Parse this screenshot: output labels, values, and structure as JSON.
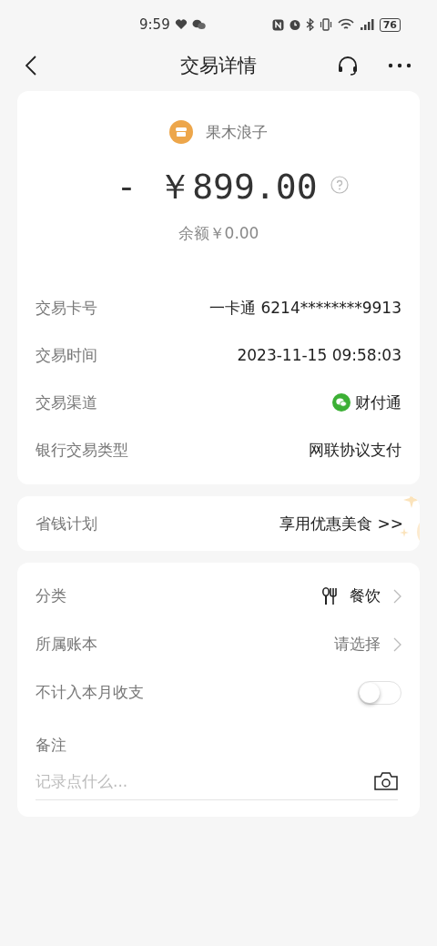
{
  "status_bar": {
    "time": "9:59",
    "battery": "76"
  },
  "nav": {
    "title": "交易详情"
  },
  "summary": {
    "merchant": "果木浪子",
    "amount": "- ￥899.00",
    "balance": "余额￥0.00"
  },
  "details": [
    {
      "kind": "text",
      "label": "交易卡号",
      "value": "一卡通 6214********9913"
    },
    {
      "kind": "text",
      "label": "交易时间",
      "value": "2023-11-15 09:58:03"
    },
    {
      "kind": "channel",
      "label": "交易渠道",
      "value": "财付通"
    },
    {
      "kind": "text",
      "label": "银行交易类型",
      "value": "网联协议支付"
    }
  ],
  "savings": {
    "label": "省钱计划",
    "link": "享用优惠美食 >>"
  },
  "settings": [
    {
      "kind": "category",
      "label": "分类",
      "value": "餐饮"
    },
    {
      "kind": "select",
      "label": "所属账本",
      "value": "请选择"
    },
    {
      "kind": "toggle",
      "label": "不计入本月收支",
      "on": false
    },
    {
      "kind": "note",
      "label": "备注",
      "placeholder": "记录点什么..."
    }
  ]
}
